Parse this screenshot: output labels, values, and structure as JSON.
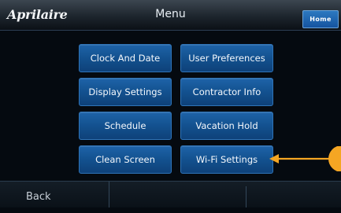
{
  "header": {
    "logo_text": "Aprilaire",
    "title": "Menu",
    "home_label": "Home"
  },
  "menu": {
    "items": [
      {
        "label": "Clock And Date"
      },
      {
        "label": "User Preferences"
      },
      {
        "label": "Display Settings"
      },
      {
        "label": "Contractor Info"
      },
      {
        "label": "Schedule"
      },
      {
        "label": "Vacation Hold"
      },
      {
        "label": "Clean Screen"
      },
      {
        "label": "Wi-Fi Settings"
      }
    ]
  },
  "footer": {
    "back_label": "Back"
  },
  "colors": {
    "button_blue": "#13518f",
    "annotation_orange": "#f5a623",
    "background": "#050a10"
  }
}
